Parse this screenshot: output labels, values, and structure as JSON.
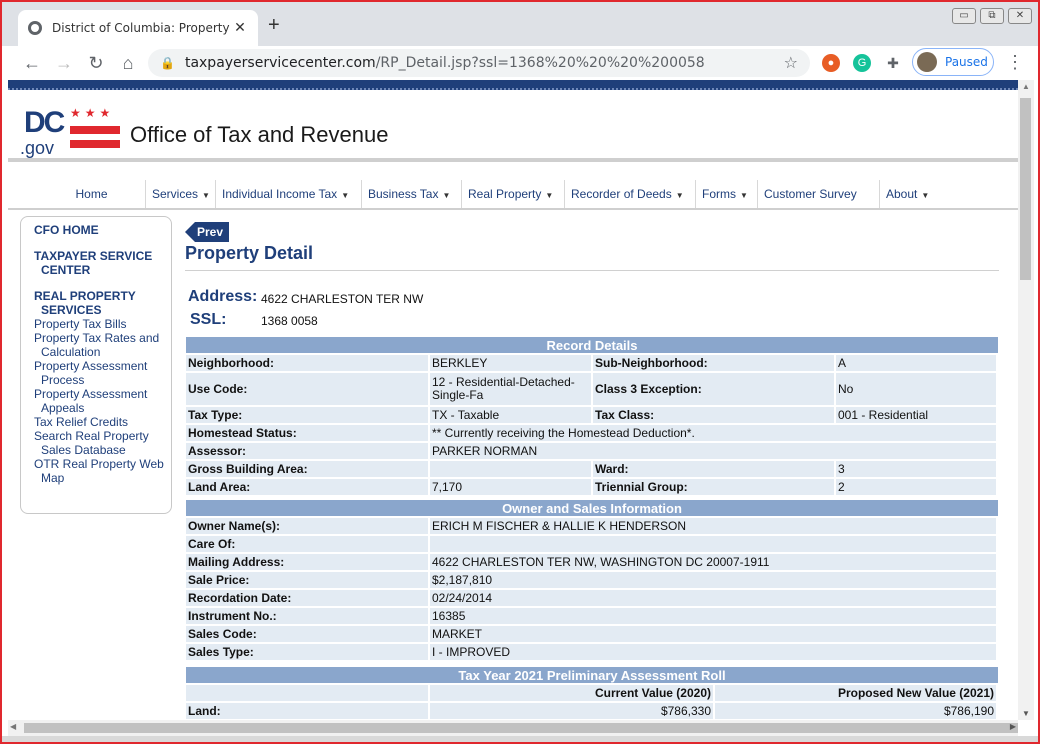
{
  "browser": {
    "tab_title": "District of Columbia: Property De",
    "tab_close": "✕",
    "new_tab": "+",
    "url_host": "taxpayerservicecenter.com",
    "url_path": "/RP_Detail.jsp?ssl=1368%20%20%20%200058",
    "profile_label": "Paused",
    "window_controls": [
      "▭",
      "⧉",
      "✕"
    ]
  },
  "site": {
    "logo_dc": "DC",
    "logo_gov": ".gov",
    "logo_stars": "★★★",
    "title": "Office of Tax and Revenue"
  },
  "nav": [
    {
      "label": "Home",
      "caret": false
    },
    {
      "label": "Services",
      "caret": true
    },
    {
      "label": "Individual Income Tax",
      "caret": true
    },
    {
      "label": "Business Tax",
      "caret": true
    },
    {
      "label": "Real Property",
      "caret": true
    },
    {
      "label": "Recorder of Deeds",
      "caret": true
    },
    {
      "label": "Forms",
      "caret": true
    },
    {
      "label": "Customer Survey",
      "caret": false
    },
    {
      "label": "About",
      "caret": true
    }
  ],
  "sidebar": {
    "cfo_home": "CFO HOME",
    "taxpayer_service_center": "TAXPAYER SERVICE CENTER",
    "real_property_services": "REAL PROPERTY SERVICES",
    "links": [
      "Property Tax Bills",
      "Property Tax Rates and Calculation",
      "Property Assessment Process",
      "Property Assessment Appeals",
      "Tax Relief Credits",
      "Search Real Property Sales Database",
      "OTR Real Property Web Map"
    ]
  },
  "page": {
    "prev_label": "Prev",
    "title": "Property Detail",
    "address_label": "Address:",
    "address_value": "4622 CHARLESTON TER NW",
    "ssl_label": "SSL:",
    "ssl_value": "1368 0058"
  },
  "record_details": {
    "heading": "Record Details",
    "rows": [
      [
        "Neighborhood:",
        "BERKLEY",
        "Sub-Neighborhood:",
        "A"
      ],
      [
        "Use Code:",
        "12  -  Residential-Detached-Single-Fa",
        "Class 3 Exception:",
        "No"
      ],
      [
        "Tax Type:",
        "TX  - Taxable",
        "Tax Class:",
        "001 -  Residential"
      ],
      [
        "Homestead Status:",
        "** Currently receiving the Homestead Deduction*.",
        "",
        ""
      ],
      [
        "Assessor:",
        "PARKER NORMAN",
        "",
        ""
      ],
      [
        "Gross Building Area:",
        "",
        "Ward:",
        "3"
      ],
      [
        "Land Area:",
        "7,170",
        "Triennial Group:",
        "2"
      ]
    ]
  },
  "owner_sales": {
    "heading": "Owner and Sales Information",
    "rows": [
      [
        "Owner Name(s):",
        "ERICH M FISCHER & HALLIE K HENDERSON"
      ],
      [
        "Care Of:",
        ""
      ],
      [
        "Mailing Address:",
        "4622 CHARLESTON TER NW, WASHINGTON DC 20007-1911"
      ],
      [
        "Sale Price:",
        "$2,187,810"
      ],
      [
        "Recordation Date:",
        "02/24/2014"
      ],
      [
        "Instrument No.:",
        "16385"
      ],
      [
        "Sales Code:",
        "MARKET"
      ],
      [
        "Sales Type:",
        "I - IMPROVED"
      ]
    ]
  },
  "assessment": {
    "heading": "Tax Year 2021 Preliminary Assessment Roll",
    "col_current": "Current Value (2020)",
    "col_proposed": "Proposed New Value (2021)",
    "rows": [
      [
        "Land:",
        "$786,330",
        "$786,190"
      ]
    ]
  }
}
